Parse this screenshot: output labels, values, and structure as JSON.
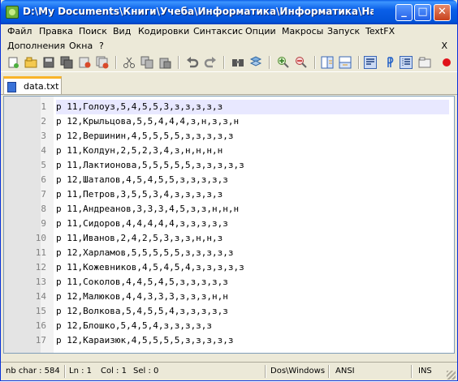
{
  "window": {
    "title": "D:\\My Documents\\Книги\\Учеба\\Информатика\\Информатика\\Наши п...",
    "minimize": "_",
    "maximize": "□",
    "close": "✕"
  },
  "menu": {
    "row1": [
      "Файл",
      "Правка",
      "Поиск",
      "Вид",
      "Кодировки",
      "Синтаксис",
      "Опции",
      "Макросы",
      "Запуск",
      "TextFX"
    ],
    "row2": [
      "Дополнения",
      "Окна",
      "?"
    ],
    "close_doc": "X"
  },
  "toolbar": {
    "icons": [
      "new-file-icon",
      "open-file-icon",
      "save-icon",
      "save-all-icon",
      "close-icon",
      "close-all-icon",
      "print-icon",
      "cut-icon",
      "copy-icon",
      "paste-icon",
      "undo-icon",
      "redo-icon",
      "find-icon",
      "replace-icon",
      "zoom-in-icon",
      "zoom-out-icon",
      "sync-vertical-icon",
      "sync-horizontal-icon",
      "word-wrap-icon",
      "show-all-chars-icon",
      "indent-guide-icon",
      "folder-icon",
      "record-macro-icon"
    ]
  },
  "tabs": [
    {
      "label": "data.txt",
      "active": true
    }
  ],
  "editor": {
    "current_line": 1,
    "lines": [
      {
        "n": "1",
        "text": "p 11,Голоуз,5,4,5,5,3,з,з,з,з,з"
      },
      {
        "n": "2",
        "text": "p 12,Крыльцова,5,5,4,4,4,з,н,з,з,н"
      },
      {
        "n": "3",
        "text": "p 12,Вершинин,4,5,5,5,5,з,з,з,з,з"
      },
      {
        "n": "4",
        "text": "p 11,Колдун,2,5,2,3,4,з,н,н,н,н"
      },
      {
        "n": "5",
        "text": "p 11,Лактионова,5,5,5,5,5,з,з,з,з,з"
      },
      {
        "n": "6",
        "text": "p 12,Шаталов,4,5,4,5,5,з,з,з,з,з"
      },
      {
        "n": "7",
        "text": "p 11,Петров,3,5,5,3,4,з,з,з,з,з"
      },
      {
        "n": "8",
        "text": "p 11,Андреанов,3,3,3,4,5,з,з,н,н,н"
      },
      {
        "n": "9",
        "text": "p 11,Сидоров,4,4,4,4,4,з,з,з,з,з"
      },
      {
        "n": "10",
        "text": "p 11,Иванов,2,4,2,5,3,з,з,н,н,з"
      },
      {
        "n": "11",
        "text": "p 12,Харламов,5,5,5,5,5,з,з,з,з,з"
      },
      {
        "n": "12",
        "text": "p 11,Кожевников,4,5,4,5,4,з,з,з,з,з"
      },
      {
        "n": "13",
        "text": "p 11,Соколов,4,4,5,4,5,з,з,з,з,з"
      },
      {
        "n": "14",
        "text": "p 12,Малюков,4,4,3,3,3,з,з,з,н,н"
      },
      {
        "n": "15",
        "text": "p 12,Волкова,5,4,5,5,4,з,з,з,з,з"
      },
      {
        "n": "16",
        "text": "p 12,Блошко,5,4,5,4,з,з,з,з,з"
      },
      {
        "n": "17",
        "text": "p 12,Караизюк,4,5,5,5,5,з,з,з,з,з"
      }
    ]
  },
  "status": {
    "chars": "nb char : 584",
    "line": "Ln : 1",
    "col": "Col : 1",
    "sel": "Sel : 0",
    "eol": "Dos\\Windows",
    "encoding": "ANSI",
    "mode": "INS"
  }
}
